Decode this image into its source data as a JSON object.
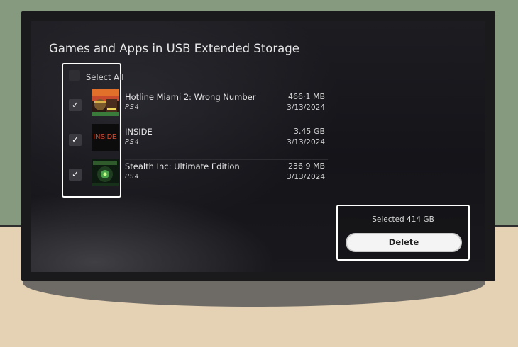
{
  "screen": {
    "title": "Games and Apps in USB Extended Storage",
    "select_all_label": "Select All"
  },
  "items": [
    {
      "name": "Hotline Miami 2: Wrong Number",
      "platform": "PS4",
      "size": "466·1 MB",
      "date": "3/13/2024",
      "checked": true,
      "thumb_text": "",
      "icon": "hotline-miami-2-cover"
    },
    {
      "name": "INSIDE",
      "platform": "PS4",
      "size": "3.45 GB",
      "date": "3/13/2024",
      "checked": true,
      "thumb_text": "INSIDE",
      "icon": "inside-cover"
    },
    {
      "name": "Stealth Inc: Ultimate Edition",
      "platform": "PS4",
      "size": "236·9 MB",
      "date": "3/13/2024",
      "checked": true,
      "thumb_text": "",
      "icon": "stealth-inc-cover"
    }
  ],
  "footer": {
    "selected_text": "Selected 414 GB",
    "delete_label": "Delete"
  },
  "colors": {
    "wall": "#859a7e",
    "floor": "#e5d1b3",
    "screen_bg": "#16161b",
    "highlight_border": "#ffffff",
    "inside_text": "#e0492c"
  }
}
